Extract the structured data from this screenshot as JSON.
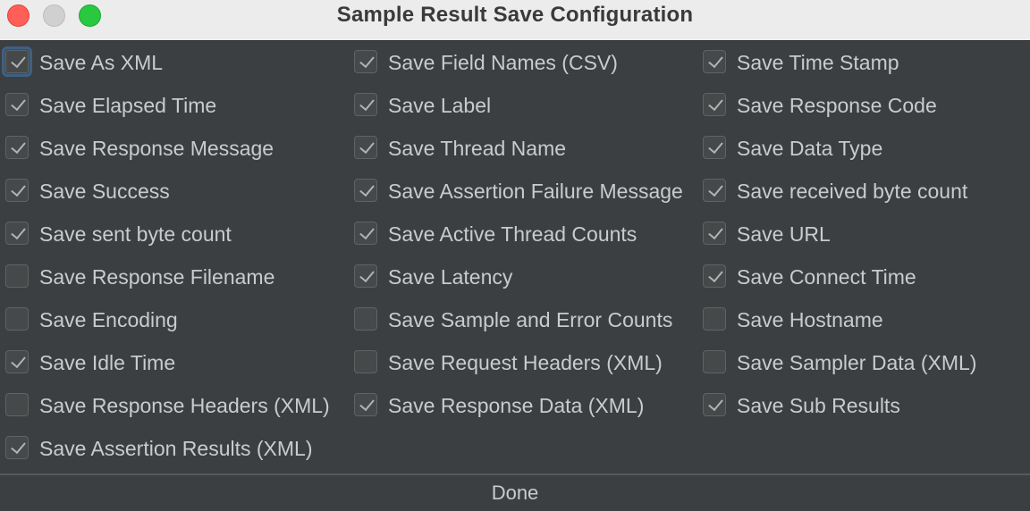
{
  "window": {
    "title": "Sample Result Save Configuration",
    "controls": [
      "close",
      "minimize",
      "zoom"
    ]
  },
  "columns": [
    {
      "items": [
        {
          "label": "Save As XML",
          "checked": true,
          "focused": true
        },
        {
          "label": "Save Elapsed Time",
          "checked": true
        },
        {
          "label": "Save Response Message",
          "checked": true
        },
        {
          "label": "Save Success",
          "checked": true
        },
        {
          "label": "Save sent byte count",
          "checked": true
        },
        {
          "label": "Save Response Filename",
          "checked": false
        },
        {
          "label": "Save Encoding",
          "checked": false
        },
        {
          "label": "Save Idle Time",
          "checked": true
        },
        {
          "label": "Save Response Headers (XML)",
          "checked": false
        },
        {
          "label": "Save Assertion Results (XML)",
          "checked": true
        }
      ]
    },
    {
      "items": [
        {
          "label": "Save Field Names (CSV)",
          "checked": true
        },
        {
          "label": "Save Label",
          "checked": true
        },
        {
          "label": "Save Thread Name",
          "checked": true
        },
        {
          "label": "Save Assertion Failure Message",
          "checked": true
        },
        {
          "label": "Save Active Thread Counts",
          "checked": true
        },
        {
          "label": "Save Latency",
          "checked": true
        },
        {
          "label": "Save Sample and Error Counts",
          "checked": false
        },
        {
          "label": "Save Request Headers (XML)",
          "checked": false
        },
        {
          "label": "Save Response Data (XML)",
          "checked": true
        }
      ]
    },
    {
      "items": [
        {
          "label": "Save Time Stamp",
          "checked": true
        },
        {
          "label": "Save Response Code",
          "checked": true
        },
        {
          "label": "Save Data Type",
          "checked": true
        },
        {
          "label": "Save received byte count",
          "checked": true
        },
        {
          "label": "Save URL",
          "checked": true
        },
        {
          "label": "Save Connect Time",
          "checked": true
        },
        {
          "label": "Save Hostname",
          "checked": false
        },
        {
          "label": "Save Sampler Data (XML)",
          "checked": false
        },
        {
          "label": "Save Sub Results",
          "checked": true
        }
      ]
    }
  ],
  "footer": {
    "done_label": "Done"
  },
  "colors": {
    "background": "#3c3f41",
    "titlebar": "#ececec",
    "text": "#c9cbcd",
    "focus_ring": "#3d6185"
  }
}
